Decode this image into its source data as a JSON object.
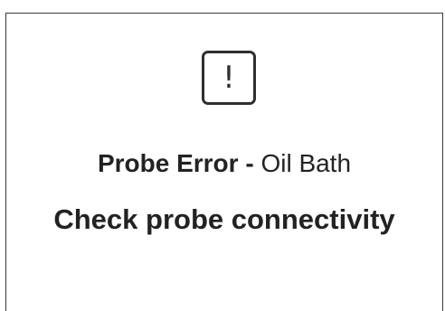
{
  "dialog": {
    "icon": "exclamation-icon",
    "icon_glyph": "!",
    "error_title": "Probe Error",
    "separator": " - ",
    "error_source": "Oil Bath",
    "message": "Check probe connectivity"
  }
}
